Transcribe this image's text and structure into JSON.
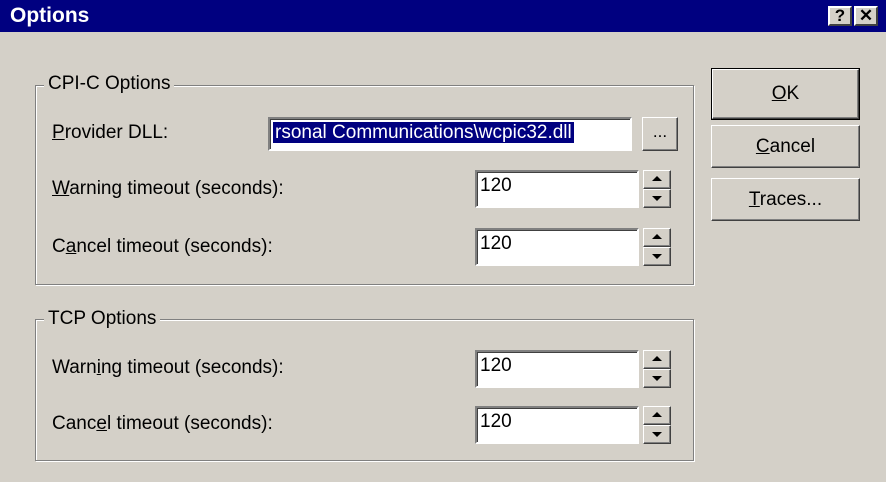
{
  "dialog": {
    "title": "Options",
    "help_glyph": "?",
    "close_glyph": "✕"
  },
  "cpic": {
    "legend": "CPI-C Options",
    "provider_label": {
      "pre": "",
      "key": "P",
      "post": "rovider DLL:"
    },
    "provider_value": "rsonal Communications\\wcpic32.dll",
    "browse_label": "...",
    "warning_label": {
      "pre": "",
      "key": "W",
      "post": "arning timeout (seconds):"
    },
    "warning_value": "120",
    "cancel_label": {
      "pre": "C",
      "key": "a",
      "post": "ncel timeout (seconds):"
    },
    "cancel_value": "120"
  },
  "tcp": {
    "legend": "TCP Options",
    "warning_label": {
      "pre": "Warn",
      "key": "i",
      "post": "ng timeout (seconds):"
    },
    "warning_value": "120",
    "cancel_label": {
      "pre": "Canc",
      "key": "e",
      "post": "l timeout (seconds):"
    },
    "cancel_value": "120"
  },
  "buttons": {
    "ok": {
      "pre": "",
      "key": "O",
      "post": "K"
    },
    "cancel": {
      "pre": "",
      "key": "C",
      "post": "ancel"
    },
    "traces": {
      "pre": "",
      "key": "T",
      "post": "races..."
    }
  },
  "icons": {
    "help": "help-icon",
    "close": "close-icon",
    "spin_up": "spin-up-arrow-icon",
    "spin_down": "spin-down-arrow-icon"
  },
  "colors": {
    "titlebar": "#000080",
    "face": "#d4d0c8",
    "selection": "#000080"
  }
}
